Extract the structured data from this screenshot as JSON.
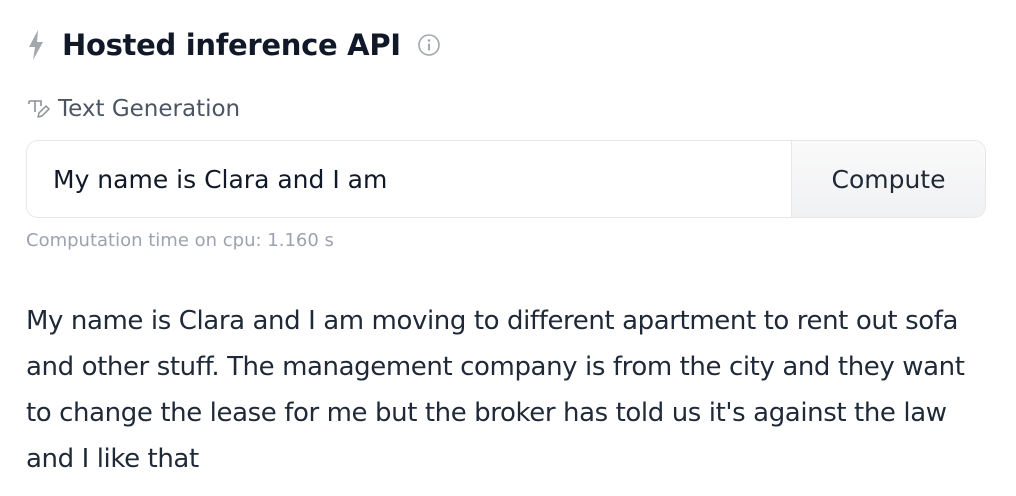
{
  "widget": {
    "title": "Hosted inference API",
    "task_label": "Text Generation",
    "input": {
      "value": "My name is Clara and I am",
      "placeholder": ""
    },
    "compute_label": "Compute",
    "timing_text": "Computation time on cpu: 1.160 s",
    "output_text": "My name is Clara and I am moving to different apartment to rent out sofa and other stuff. The management company is from the city and they want to change the lease for me but the broker has told us it's against the law and I like that"
  },
  "icons": {
    "header": "lightning-bolt-icon",
    "info": "info-icon",
    "task": "text-generation-icon"
  },
  "colors": {
    "title": "#111827",
    "muted": "#9ca3af",
    "icon": "#9ca3af",
    "border": "#e5e7eb",
    "button_bg": "#f3f4f6"
  }
}
